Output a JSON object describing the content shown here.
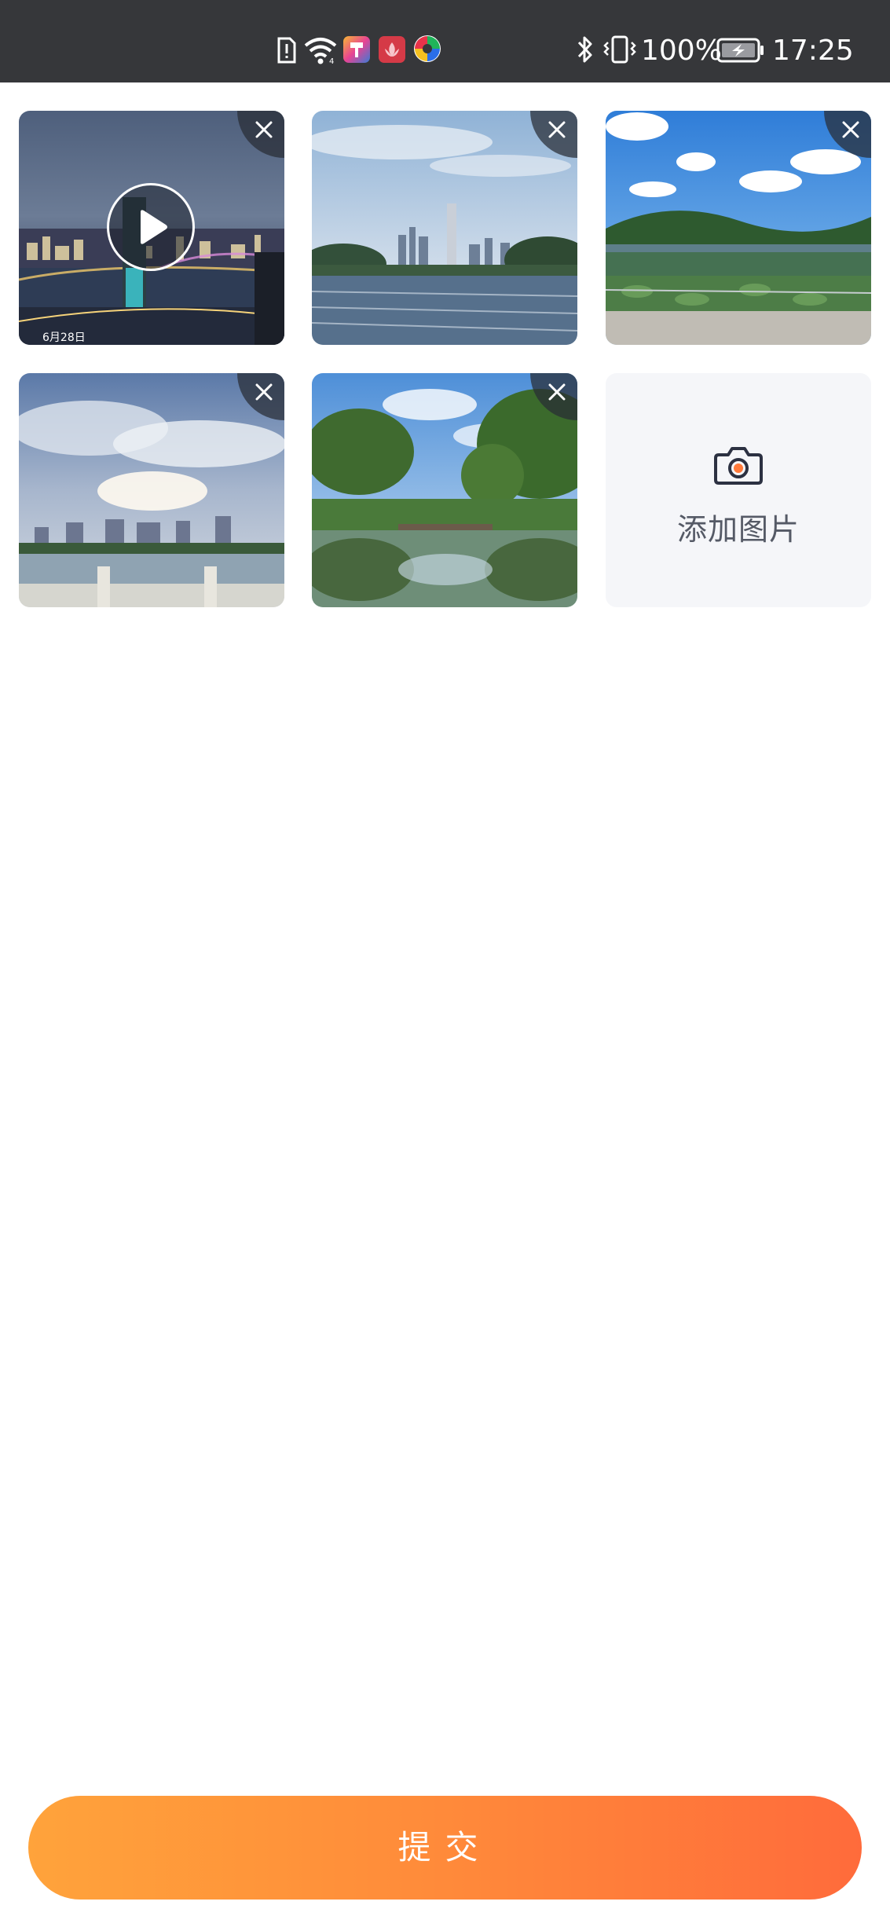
{
  "status_bar": {
    "battery_percent": "100%",
    "time": "17:25",
    "icons": [
      "sim-alert-icon",
      "wifi-icon",
      "app-notification-icon",
      "app-notification-icon",
      "app-notification-icon",
      "bluetooth-icon",
      "vibrate-icon",
      "battery-charging-icon"
    ]
  },
  "media": [
    {
      "type": "video",
      "scene": "night-city-river",
      "date_overlay": "6月28日",
      "removable": true
    },
    {
      "type": "image",
      "scene": "skyline-lake",
      "removable": true
    },
    {
      "type": "image",
      "scene": "lotus-pond-park",
      "removable": true
    },
    {
      "type": "image",
      "scene": "sunset-clouds-waterfront",
      "removable": true
    },
    {
      "type": "image",
      "scene": "trees-pond-bridge",
      "removable": true
    }
  ],
  "add_tile": {
    "label": "添加图片",
    "icon": "camera-icon"
  },
  "submit": {
    "label": "提交"
  },
  "colors": {
    "accent_start": "#ffa33b",
    "accent_end": "#ff6b3b",
    "status_bar": "#36373a",
    "add_tile_bg": "#f5f6f9"
  }
}
